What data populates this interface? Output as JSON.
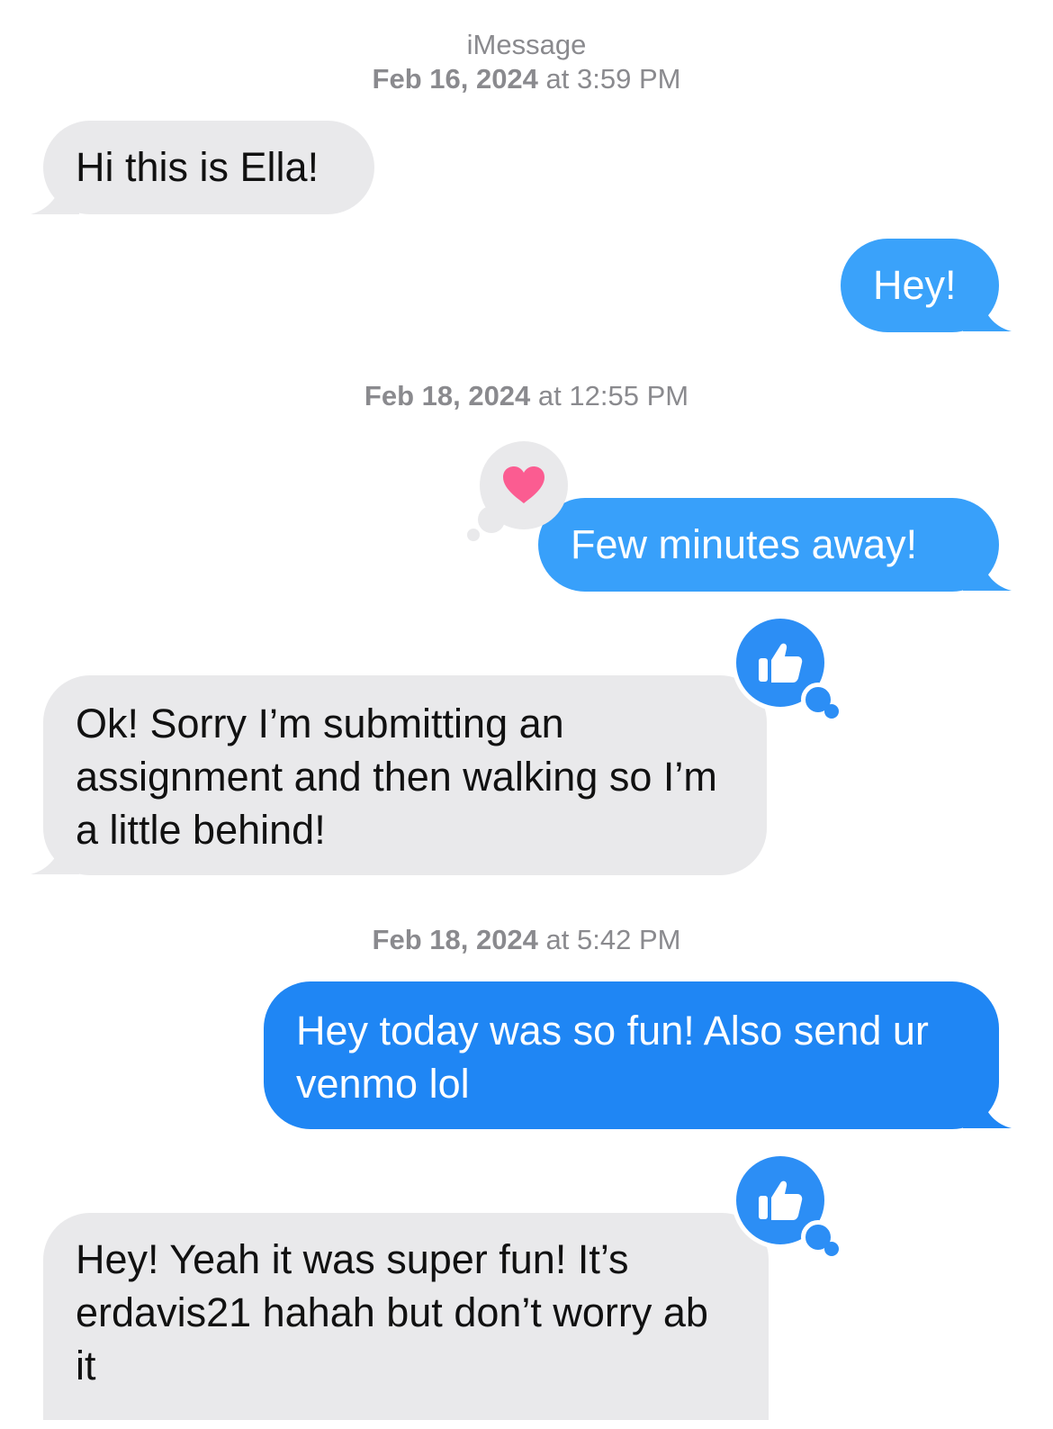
{
  "header": {
    "service": "iMessage",
    "date": "Feb 16, 2024",
    "at": "at",
    "time": "3:59 PM"
  },
  "timestamps": [
    {
      "date": "Feb 18, 2024",
      "at": "at",
      "time": "12:55 PM"
    },
    {
      "date": "Feb 18, 2024",
      "at": "at",
      "time": "5:42 PM"
    }
  ],
  "messages": [
    {
      "direction": "received",
      "text": "Hi this is Ella!"
    },
    {
      "direction": "sent",
      "text": "Hey!"
    },
    {
      "direction": "sent",
      "text": "Few minutes away!",
      "reaction": "heart-icon"
    },
    {
      "direction": "received",
      "text": "Ok! Sorry I’m submitting an assignment and then walking so I’m a little behind!",
      "reaction": "thumbs-up-icon"
    },
    {
      "direction": "sent",
      "text": "Hey today was so fun! Also send ur venmo lol"
    },
    {
      "direction": "received",
      "text": "Hey! Yeah it was super fun! It’s erdavis21 hahah but don’t worry ab it",
      "reaction": "thumbs-up-icon"
    }
  ],
  "colors": {
    "received_bubble": "#e9e9eb",
    "sent_bubble": "#2c8ef5",
    "sent_bubble_top": "#3ea6fb",
    "timestamp_text": "#8a8a8e",
    "heart": "#fb5c91"
  }
}
